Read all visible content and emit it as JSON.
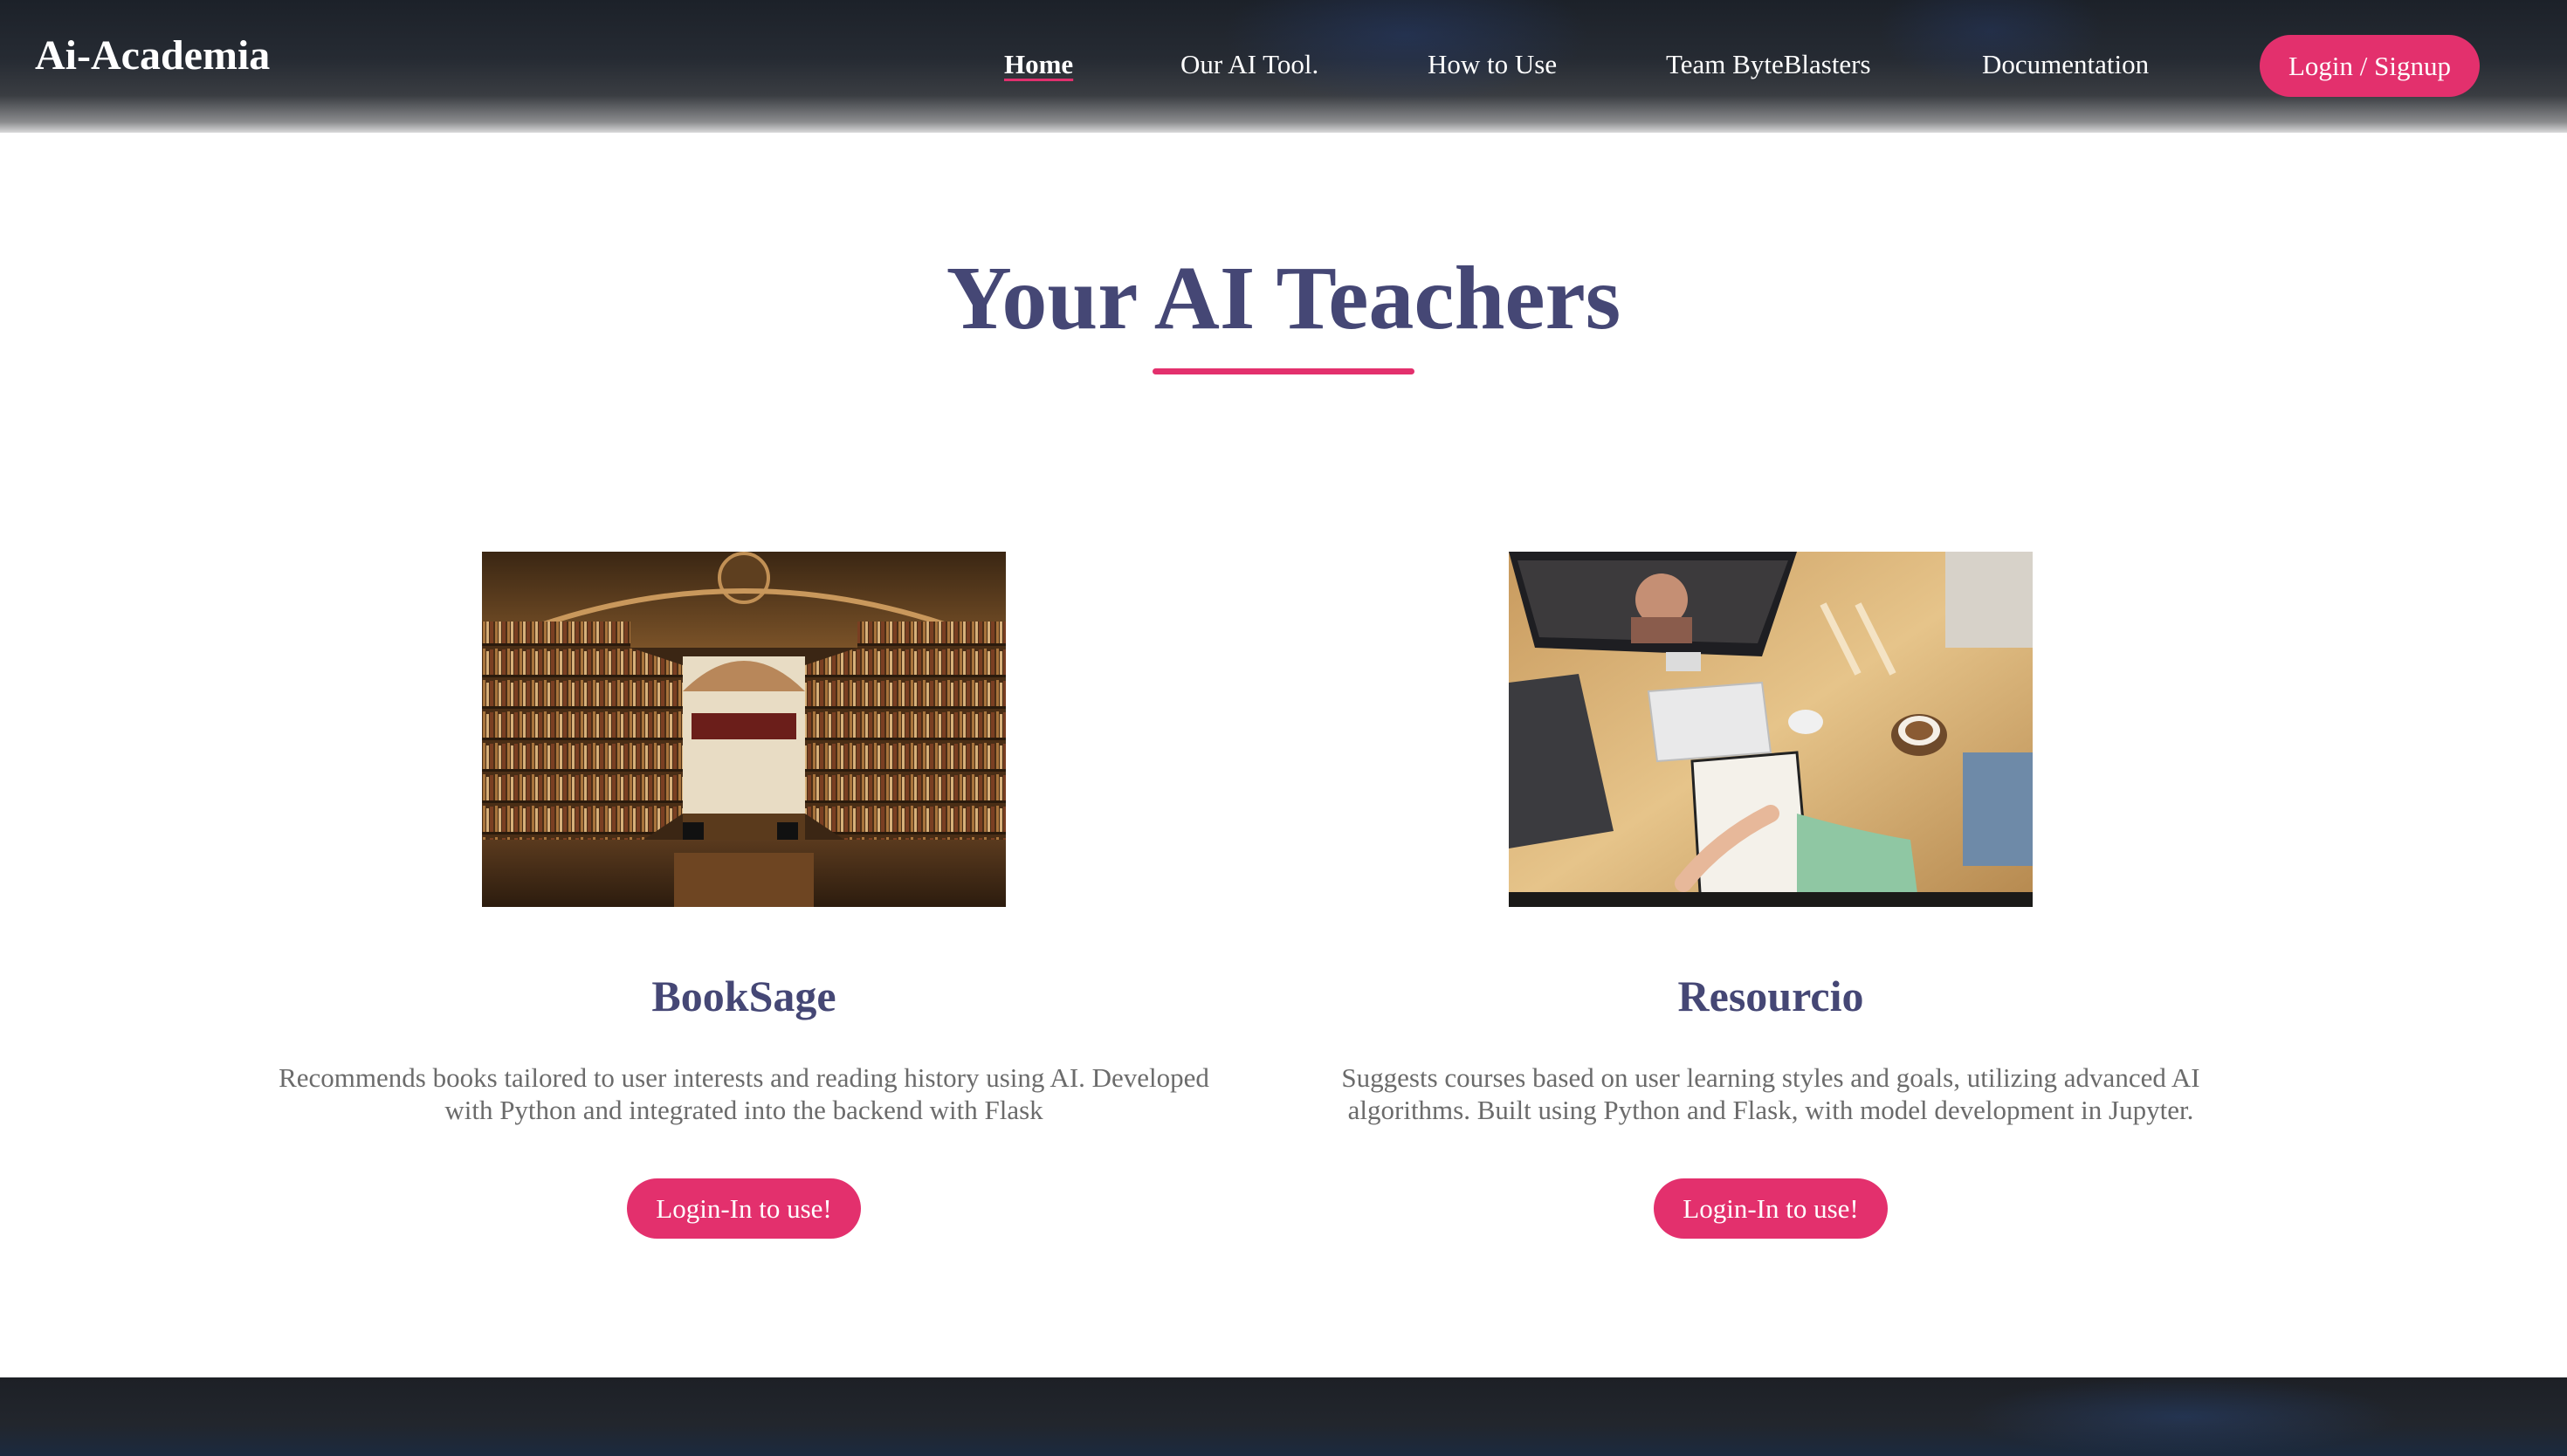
{
  "header": {
    "logo": "Ai-Academia",
    "nav": [
      {
        "label": "Home",
        "active": true
      },
      {
        "label": "Our AI Tool."
      },
      {
        "label": "How to Use"
      },
      {
        "label": "Team ByteBlasters"
      },
      {
        "label": "Documentation"
      }
    ],
    "login_label": "Login / Signup"
  },
  "main": {
    "title": "Your AI Teachers",
    "cards": [
      {
        "image": "library-photo",
        "title": "BookSage",
        "description": "Recommends books tailored to user interests and reading history using AI. Developed with Python and integrated into the backend with Flask",
        "button_label": "Login-In to use!"
      },
      {
        "image": "desk-workspace-photo",
        "title": "Resourcio",
        "description": "Suggests courses based on user learning styles and goals, utilizing advanced AI algorithms. Built using Python and Flask, with model development in Jupyter.",
        "button_label": "Login-In to use!"
      }
    ]
  },
  "colors": {
    "accent": "#e3306d",
    "heading": "#454775",
    "body_text": "#6b6b6b",
    "header_bg": "#262b33"
  }
}
